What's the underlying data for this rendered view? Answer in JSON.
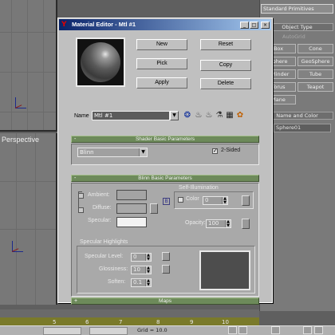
{
  "background": {
    "viewport_label": "Perspective",
    "command_panel": {
      "category_select": "Standard Primitives",
      "object_type_header": "Object Type",
      "autogrid_label": "AutoGrid",
      "buttons": [
        "Box",
        "Cone",
        "Sphere",
        "GeoSphere",
        "Cylinder",
        "Tube",
        "Torus",
        "Teapot",
        "Plane"
      ],
      "name_color_header": "Name and Color",
      "name_field_value": "Sphere01"
    },
    "ruler_numbers": [
      "5",
      "6",
      "7",
      "8",
      "9",
      "10"
    ],
    "status_text": "Grid = 10.0"
  },
  "dialog": {
    "title": "Material Editor - Mtl #1",
    "title_buttons": [
      "_",
      "□",
      "×"
    ],
    "buttons": {
      "new": "New",
      "reset": "Reset",
      "pick": "Pick",
      "copy": "Copy",
      "apply": "Apply",
      "delete": "Delete"
    },
    "name_label": "Name",
    "material_name": "Mtl #1",
    "shader_rollout": {
      "title": "Shader Basic Parameters",
      "shader_value": "Blinn",
      "two_sided_label": "2-Sided",
      "two_sided_checked": true
    },
    "blinn_rollout": {
      "title": "Blinn Basic Parameters",
      "ambient_label": "Ambient:",
      "diffuse_label": "Diffuse:",
      "specular_label": "Specular:",
      "lock_glyph": "B",
      "self_illum_title": "Self-Illumination",
      "color_label": "Color",
      "self_illum_value": "0",
      "opacity_label": "Opacity:",
      "opacity_value": "100",
      "specular_highlights_title": "Specular Highlights",
      "specular_level_label": "Specular Level:",
      "specular_level_value": "0",
      "glossiness_label": "Glossiness:",
      "glossiness_value": "10",
      "soften_label": "Soften:",
      "soften_value": "0.1"
    },
    "maps_rollout": {
      "title": "Maps"
    },
    "colors": {
      "ambient": "#a4a4a4",
      "diffuse": "#a8a8a8",
      "specular": "#f2f2f2",
      "rollout_bar": "#6d8a5a"
    }
  }
}
